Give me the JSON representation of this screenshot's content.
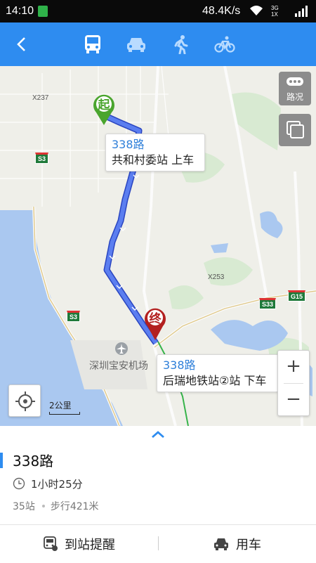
{
  "status": {
    "time": "14:10",
    "speed": "48.4K/s",
    "net_top": "3G",
    "net_bottom": "1X"
  },
  "map": {
    "labels": {
      "x237": "X237",
      "x253": "X253",
      "s3_a": "S3",
      "s3_b": "S3",
      "s33": "S33",
      "g15": "G15",
      "airport": "深圳宝安机场"
    },
    "start_marker": "起",
    "end_marker": "终",
    "start_callout": {
      "route": "338路",
      "stop": "共和村委站 上车"
    },
    "end_callout": {
      "route": "338路",
      "stop": "后瑞地铁站②站 下车"
    },
    "traffic_label": "路况",
    "scale_label": "2公里",
    "zoom_in": "+",
    "zoom_out": "−"
  },
  "detail": {
    "route_name": "338路",
    "duration": "1小时25分",
    "stations": "35站",
    "walk": "步行421米"
  },
  "actions": {
    "remind": "到站提醒",
    "car": "用车"
  },
  "colors": {
    "accent": "#2e8cf0",
    "route_line": "#4a72e0",
    "start": "#4aa52e",
    "end": "#b32020"
  }
}
